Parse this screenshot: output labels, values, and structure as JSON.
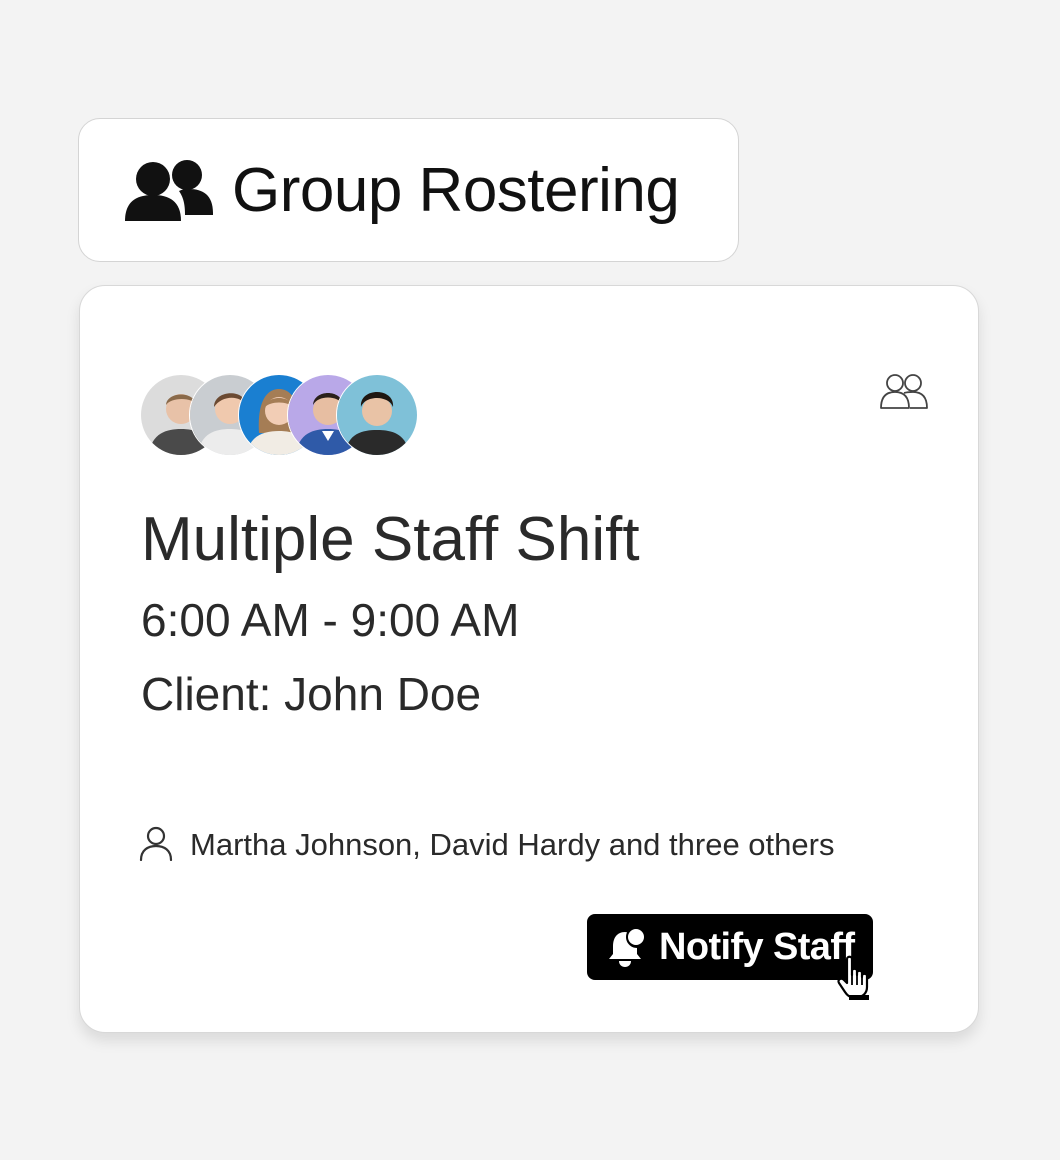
{
  "header": {
    "title": "Group Rostering",
    "icon": "users-filled-icon"
  },
  "shift_card": {
    "avatars": [
      {
        "name": "avatar-1",
        "bg": "#d9d9d9",
        "shirt": "#4a4a4a",
        "hair": "#8a6a4a"
      },
      {
        "name": "avatar-2",
        "bg": "#c8ccd0",
        "shirt": "#e8e8e8",
        "hair": "#6b4a32"
      },
      {
        "name": "avatar-3",
        "bg": "#1a7fd1",
        "shirt": "#f1ece4",
        "hair": "#a57d55"
      },
      {
        "name": "avatar-4",
        "bg": "#b9a8e8",
        "shirt": "#2f5aa8",
        "hair": "#2a201a"
      },
      {
        "name": "avatar-5",
        "bg": "#7fc1d8",
        "shirt": "#2a2a2a",
        "hair": "#1f1711"
      }
    ],
    "corner_icon": "users-outline-icon",
    "title": "Multiple Staff Shift",
    "time": "6:00 AM - 9:00 AM",
    "client": "Client: John Doe",
    "staff_summary": "Martha Johnson, David Hardy and three others",
    "notify_button_label": "Notify Staff"
  },
  "colors": {
    "background": "#f3f3f3",
    "card": "#ffffff",
    "button": "#000000",
    "button_text": "#ffffff"
  }
}
